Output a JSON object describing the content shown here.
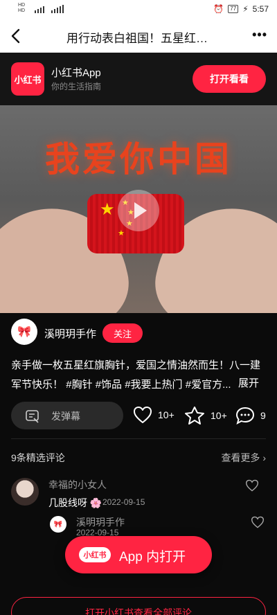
{
  "status_bar": {
    "left_top": "HD",
    "left_bottom": "HD",
    "signal_1": "5G",
    "signal_2": "4G",
    "battery": "77",
    "time": "5:57"
  },
  "nav": {
    "title": "用行动表白祖国！五星红…",
    "more": "•••"
  },
  "app_banner": {
    "logo_text": "小红书",
    "app_name": "小红书App",
    "slogan": "你的生活指南",
    "open_label": "打开看看"
  },
  "video": {
    "caption": "我爱你中国"
  },
  "author": {
    "name": "溪明玥手作",
    "follow_label": "关注"
  },
  "description": {
    "text": "亲手做一枚五星红旗胸针，爱国之情油然而生！八一建军节快乐！",
    "tags": [
      "#胸针",
      "#饰品",
      "#我要上热门",
      "#爱官方..."
    ],
    "expand_label": "展开"
  },
  "actions": {
    "danmaku_placeholder": "发弹幕",
    "likes": "10+",
    "collects": "10+",
    "comments": "9"
  },
  "comments": {
    "title": "9条精选评论",
    "see_more": "查看更多",
    "items": [
      {
        "user": "幸福的小女人",
        "text": "几股线呀",
        "date": "2022-09-15"
      }
    ],
    "reply": {
      "user": "溪明玥手作",
      "date": "2022-09-15"
    }
  },
  "float_cta": {
    "logo_text": "小红书",
    "label": "App 内打开"
  },
  "bottom_button": {
    "label": "打开小红书查看全部评论"
  },
  "colors": {
    "brand": "#ff2442",
    "background": "#0b0b0b"
  }
}
